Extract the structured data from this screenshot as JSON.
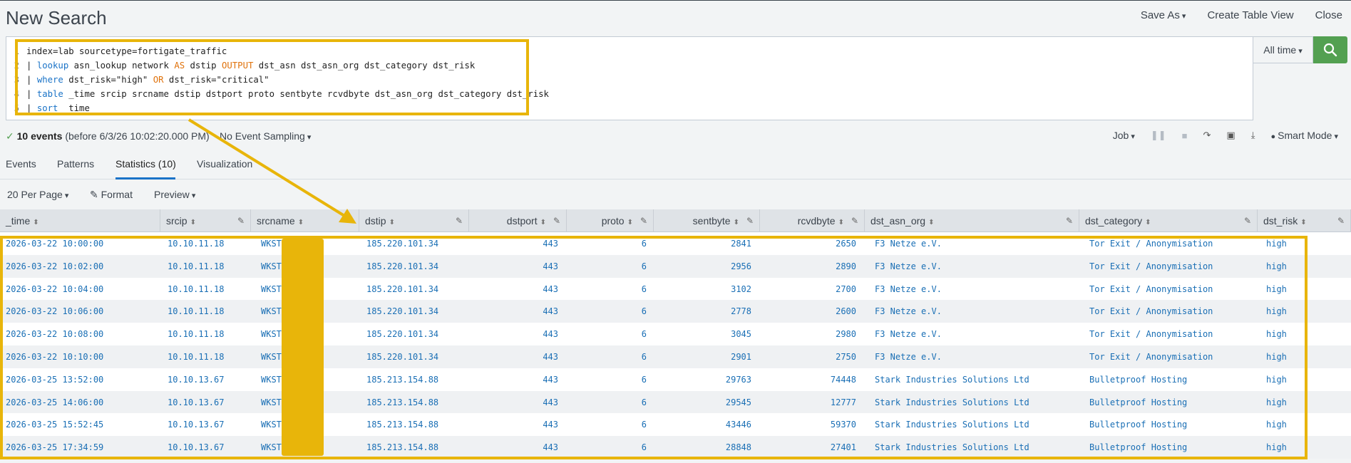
{
  "header": {
    "title": "New Search",
    "save_as": "Save As",
    "create_table_view": "Create Table View",
    "close": "Close"
  },
  "search": {
    "line_numbers": [
      "1",
      "2",
      "3",
      "4",
      "5"
    ],
    "query_lines": [
      [
        {
          "t": "index=lab sourcetype=fortigate_traffic",
          "c": ""
        }
      ],
      [
        {
          "t": "| ",
          "c": ""
        },
        {
          "t": "lookup",
          "c": "kw"
        },
        {
          "t": " asn_lookup network ",
          "c": ""
        },
        {
          "t": "AS",
          "c": "op"
        },
        {
          "t": " dstip ",
          "c": ""
        },
        {
          "t": "OUTPUT",
          "c": "op"
        },
        {
          "t": " dst_asn dst_asn_org dst_category dst_risk",
          "c": ""
        }
      ],
      [
        {
          "t": "| ",
          "c": ""
        },
        {
          "t": "where",
          "c": "kw"
        },
        {
          "t": " dst_risk=\"high\" ",
          "c": ""
        },
        {
          "t": "OR",
          "c": "op"
        },
        {
          "t": " dst_risk=\"critical\"",
          "c": ""
        }
      ],
      [
        {
          "t": "| ",
          "c": ""
        },
        {
          "t": "table",
          "c": "kw"
        },
        {
          "t": " _time srcip srcname dstip dstport proto sentbyte rcvdbyte dst_asn_org dst_category dst_risk",
          "c": ""
        }
      ],
      [
        {
          "t": "| ",
          "c": ""
        },
        {
          "t": "sort",
          "c": "kw"
        },
        {
          "t": " _time",
          "c": ""
        }
      ]
    ],
    "time_range": "All time"
  },
  "status": {
    "check": "✓",
    "events_count": "10 events",
    "events_detail": "(before 6/3/26 10:02:20.000 PM)",
    "sampling": "No Event Sampling",
    "job": "Job",
    "mode": "Smart Mode"
  },
  "tabs": [
    "Events",
    "Patterns",
    "Statistics (10)",
    "Visualization"
  ],
  "options": {
    "per_page": "20 Per Page",
    "format": "Format",
    "preview": "Preview"
  },
  "table": {
    "columns": [
      "_time",
      "srcip",
      "srcname",
      "dstip",
      "dstport",
      "proto",
      "sentbyte",
      "rcvdbyte",
      "dst_asn_org",
      "dst_category",
      "dst_risk"
    ],
    "rows": [
      [
        "2026-03-22 10:00:00",
        "10.10.11.18",
        "WKST",
        "185.220.101.34",
        "443",
        "6",
        "2841",
        "2650",
        "F3 Netze e.V.",
        "Tor Exit / Anonymisation",
        "high"
      ],
      [
        "2026-03-22 10:02:00",
        "10.10.11.18",
        "WKST",
        "185.220.101.34",
        "443",
        "6",
        "2956",
        "2890",
        "F3 Netze e.V.",
        "Tor Exit / Anonymisation",
        "high"
      ],
      [
        "2026-03-22 10:04:00",
        "10.10.11.18",
        "WKST",
        "185.220.101.34",
        "443",
        "6",
        "3102",
        "2700",
        "F3 Netze e.V.",
        "Tor Exit / Anonymisation",
        "high"
      ],
      [
        "2026-03-22 10:06:00",
        "10.10.11.18",
        "WKST",
        "185.220.101.34",
        "443",
        "6",
        "2778",
        "2600",
        "F3 Netze e.V.",
        "Tor Exit / Anonymisation",
        "high"
      ],
      [
        "2026-03-22 10:08:00",
        "10.10.11.18",
        "WKST",
        "185.220.101.34",
        "443",
        "6",
        "3045",
        "2980",
        "F3 Netze e.V.",
        "Tor Exit / Anonymisation",
        "high"
      ],
      [
        "2026-03-22 10:10:00",
        "10.10.11.18",
        "WKST",
        "185.220.101.34",
        "443",
        "6",
        "2901",
        "2750",
        "F3 Netze e.V.",
        "Tor Exit / Anonymisation",
        "high"
      ],
      [
        "2026-03-25 13:52:00",
        "10.10.13.67",
        "WKST",
        "185.213.154.88",
        "443",
        "6",
        "29763",
        "74448",
        "Stark Industries Solutions Ltd",
        "Bulletproof Hosting",
        "high"
      ],
      [
        "2026-03-25 14:06:00",
        "10.10.13.67",
        "WKST",
        "185.213.154.88",
        "443",
        "6",
        "29545",
        "12777",
        "Stark Industries Solutions Ltd",
        "Bulletproof Hosting",
        "high"
      ],
      [
        "2026-03-25 15:52:45",
        "10.10.13.67",
        "WKST",
        "185.213.154.88",
        "443",
        "6",
        "43446",
        "59370",
        "Stark Industries Solutions Ltd",
        "Bulletproof Hosting",
        "high"
      ],
      [
        "2026-03-25 17:34:59",
        "10.10.13.67",
        "WKST",
        "185.213.154.88",
        "443",
        "6",
        "28848",
        "27401",
        "Stark Industries Solutions Ltd",
        "Bulletproof Hosting",
        "high"
      ]
    ]
  },
  "colors": {
    "highlight": "#e8b50a",
    "link": "#1a6fb5",
    "search_button": "#53a051",
    "keyword": "#1a73c7",
    "operator": "#e0720b"
  }
}
